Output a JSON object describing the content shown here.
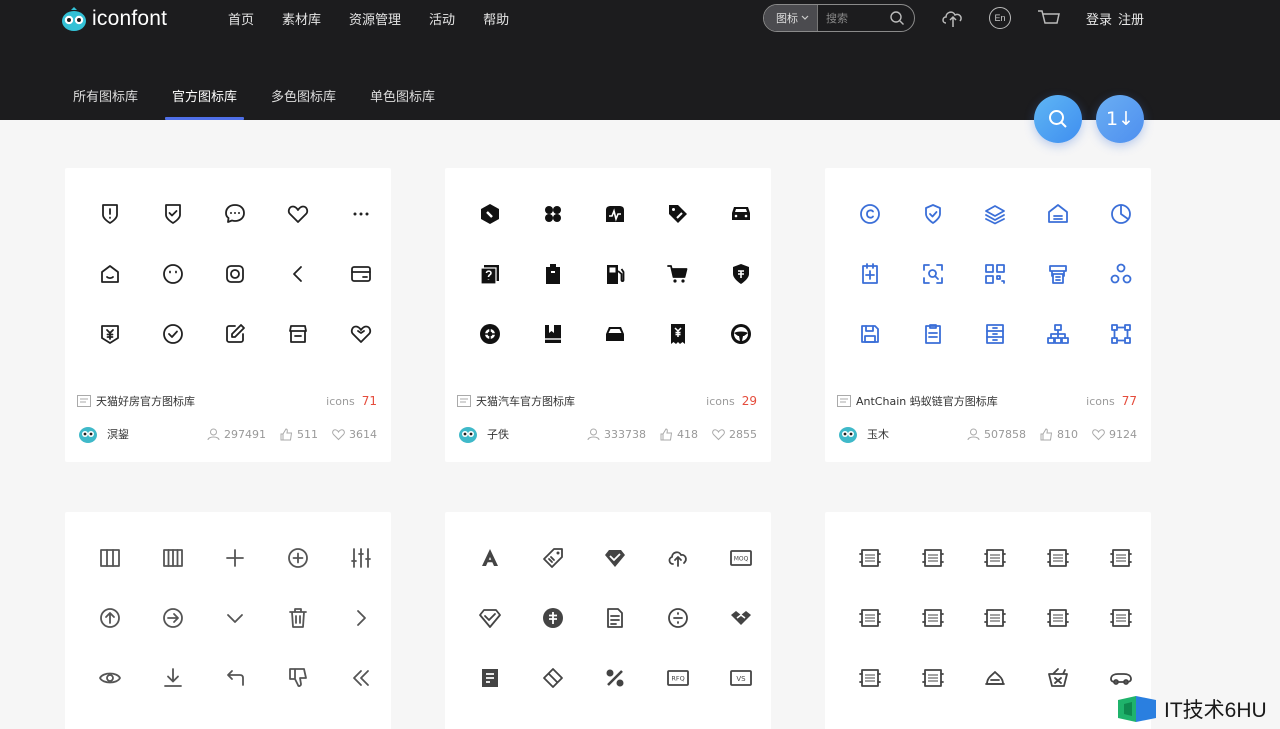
{
  "brand": {
    "name": "iconfont"
  },
  "nav": [
    "首页",
    "素材库",
    "资源管理",
    "活动",
    "帮助"
  ],
  "search": {
    "type_label": "图标",
    "placeholder": "搜索"
  },
  "header_icons": [
    "upload-cloud-icon",
    "language-icon",
    "cart-icon"
  ],
  "lang_label": "En",
  "auth": {
    "login": "登录",
    "register": "注册"
  },
  "tabs": [
    "所有图标库",
    "官方图标库",
    "多色图标库",
    "单色图标库"
  ],
  "active_tab": "官方图标库",
  "fab": {
    "sort_label": "1↓"
  },
  "colors": {
    "header_bg": "#1c1c1e",
    "accent": "#4f6fe8",
    "count_red": "#e54c3c",
    "antchain_blue": "#3b6fd8",
    "fab_blue": "#4a9bf2"
  },
  "cards": [
    {
      "name": "天猫好房官方图标库",
      "count_label": "icons",
      "count": "71",
      "user": "溟鋆",
      "views": "297491",
      "likes": "511",
      "favorites": "3614",
      "icons": [
        "shield-alert-icon",
        "shield-check-icon",
        "chat-bubble-icon",
        "heart-icon",
        "more-icon",
        "home-icon",
        "smile-icon",
        "instagram-icon",
        "chevron-left-icon",
        "card-icon",
        "price-tag-yen-icon",
        "check-circle-icon",
        "edit-icon",
        "store-icon",
        "heart-outline-icon"
      ]
    },
    {
      "name": "天猫汽车官方图标库",
      "count_label": "icons",
      "count": "29",
      "user": "子佚",
      "views": "333738",
      "likes": "418",
      "favorites": "2855",
      "icons": [
        "wrench-hex-icon",
        "grid-clover-icon",
        "car-pulse-icon",
        "tag-pen-icon",
        "car-front-icon",
        "doc-question-icon",
        "battery-icon",
        "fuel-station-icon",
        "cart-icon",
        "shield-insurance-icon",
        "wheel-icon",
        "book-icon",
        "car-icon",
        "receipt-yen-icon",
        "steering-wheel-icon"
      ]
    },
    {
      "name": "AntChain 蚂蚁链官方图标库",
      "count_label": "icons",
      "count": "77",
      "user": "玉木",
      "views": "507858",
      "likes": "810",
      "favorites": "9124",
      "icons": [
        "copyright-icon",
        "shield-icon",
        "layers-icon",
        "house-icon",
        "pie-chart-icon",
        "add-file-icon",
        "scan-search-icon",
        "qr-code-icon",
        "printer-icon",
        "nodes-icon",
        "save-icon",
        "clipboard-icon",
        "database-icon",
        "hierarchy-icon",
        "network-icon"
      ]
    },
    {
      "name": "",
      "icons": [
        "columns-3-icon",
        "columns-4-icon",
        "plus-icon",
        "plus-circle-icon",
        "sliders-icon",
        "arrow-up-circle-icon",
        "arrow-right-circle-icon",
        "chevron-down-icon",
        "trash-icon",
        "chevron-right-icon",
        "eye-icon",
        "download-icon",
        "undo-icon",
        "dislike-icon",
        "double-chevron-left-icon"
      ]
    },
    {
      "name": "",
      "icons": [
        "font-a-icon",
        "tag-icon",
        "diamond-check-icon",
        "cloud-upload-icon",
        "moq-badge-icon",
        "diamond-outline-icon",
        "coin-icon",
        "doc-lines-icon",
        "circle-divide-icon",
        "handshake-icon",
        "report-icon",
        "diamond-box-icon",
        "percent-icon",
        "rfq-badge-icon",
        "vs-badge-icon"
      ]
    },
    {
      "name": "",
      "icons": [
        "label-box-1-icon",
        "label-box-2-icon",
        "label-box-3-icon",
        "label-box-4-icon",
        "label-box-5-icon",
        "label-box-6-icon",
        "label-box-7-icon",
        "label-box-8-icon",
        "label-box-9-icon",
        "label-box-10-icon",
        "label-box-11-icon",
        "label-box-12-icon",
        "cake-icon",
        "basket-icon",
        "car-side-icon"
      ]
    }
  ],
  "watermark": "IT技术6HU"
}
